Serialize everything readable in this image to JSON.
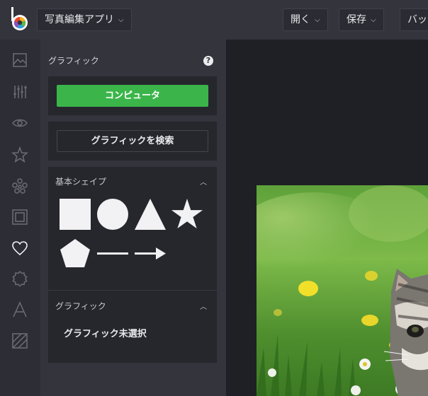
{
  "topbar": {
    "app_menu_label": "写真編集アプリ",
    "open_label": "開く",
    "save_label": "保存",
    "batch_label": "バッチ"
  },
  "panel": {
    "title": "グラフィック",
    "help_label": "?",
    "computer_button": "コンピュータ",
    "search_button": "グラフィックを検索",
    "basic_shapes": {
      "title": "基本シェイプ",
      "shapes": [
        "square",
        "circle",
        "triangle",
        "star",
        "pentagon",
        "line",
        "arrow"
      ]
    },
    "graphic_section": {
      "title": "グラフィック",
      "empty_text": "グラフィック未選択"
    }
  },
  "rail": {
    "icons": [
      "image-icon",
      "adjust-sliders-icon",
      "eye-icon",
      "star-icon",
      "flower-icon",
      "frame-icon",
      "heart-icon",
      "badge-icon",
      "text-icon",
      "texture-icon"
    ],
    "active": "heart-icon"
  },
  "colors": {
    "topbar_bg": "#33343c",
    "rail_bg": "#2d2e35",
    "panel_bg": "#33343c",
    "card_bg": "#26272d",
    "canvas_bg": "#1f2026",
    "accent_green": "#3bb54a"
  }
}
